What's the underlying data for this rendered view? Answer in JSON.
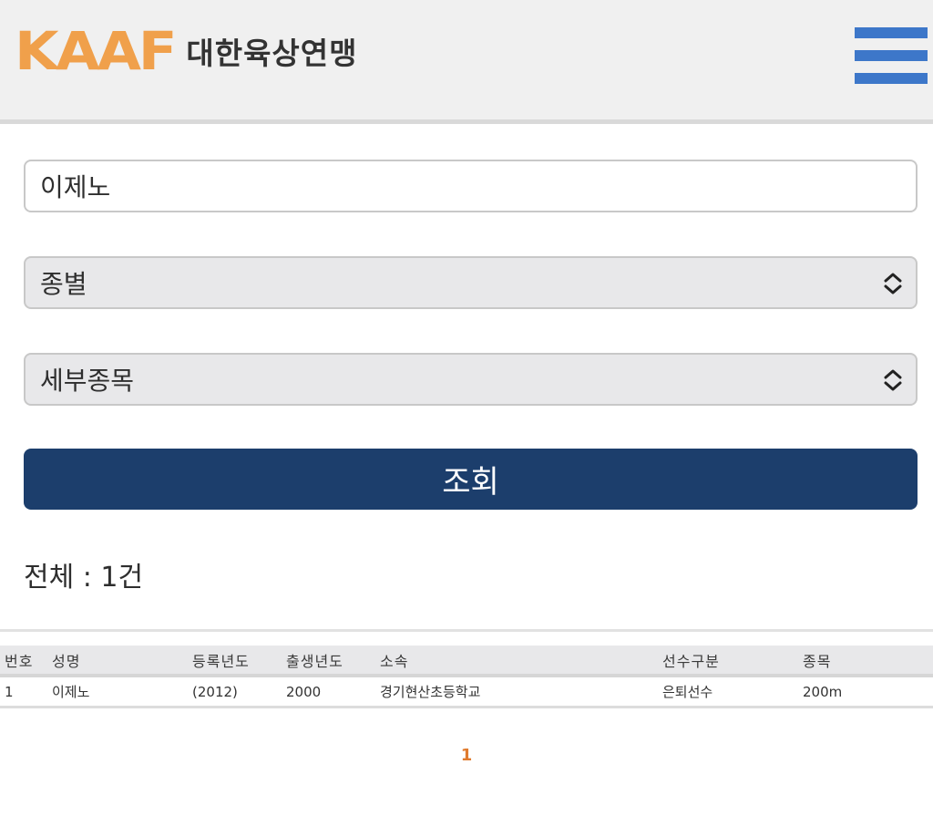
{
  "header": {
    "logo_mark": "KAAF",
    "logo_text": "대한육상연맹",
    "menu_icon": "hamburger-menu-icon",
    "menu_color": "#3d77c9"
  },
  "search": {
    "name_value": "이제노",
    "gender_select": "종별",
    "event_select": "세부종목",
    "button_label": "조회",
    "button_color": "#1c3e6c"
  },
  "results": {
    "total_label": "전체 : 1건",
    "columns": [
      "번호",
      "성명",
      "등록년도",
      "출생년도",
      "소속",
      "선수구분",
      "종목"
    ],
    "rows": [
      [
        "1",
        "이제노",
        "(2012)",
        "2000",
        "경기현산초등학교",
        "은퇴선수",
        "200m"
      ]
    ]
  },
  "pagination": {
    "current_page": "1",
    "accent_color": "#e07b2e"
  }
}
